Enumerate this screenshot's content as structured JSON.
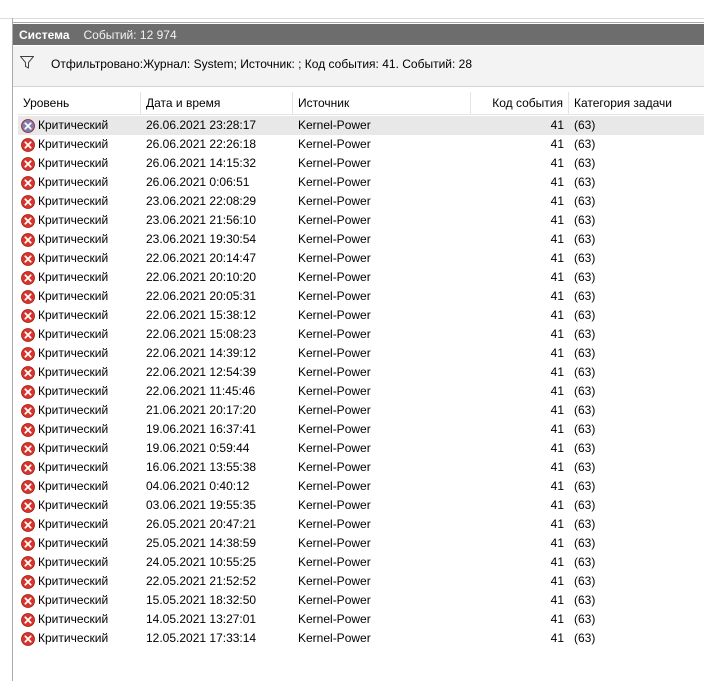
{
  "title_bar": {
    "name": "Система",
    "count": "Событий: 12 974"
  },
  "filter": {
    "text": "Отфильтровано:Журнал: System; Источник: ; Код события: 41. Событий: 28"
  },
  "columns": [
    "Уровень",
    "Дата и время",
    "Источник",
    "Код события",
    "Категория задачи"
  ],
  "colors": {
    "title_bar": "#6d6d6d",
    "filter_bar": "#f3f3f3",
    "error_red": "#d9342b",
    "selected_row": "#e8e8e8"
  },
  "rows": [
    {
      "level": "Критический",
      "datetime": "26.06.2021 23:28:17",
      "source": "Kernel-Power",
      "code": "41",
      "category": "(63)",
      "selected": true
    },
    {
      "level": "Критический",
      "datetime": "26.06.2021 22:26:18",
      "source": "Kernel-Power",
      "code": "41",
      "category": "(63)"
    },
    {
      "level": "Критический",
      "datetime": "26.06.2021 14:15:32",
      "source": "Kernel-Power",
      "code": "41",
      "category": "(63)"
    },
    {
      "level": "Критический",
      "datetime": "26.06.2021 0:06:51",
      "source": "Kernel-Power",
      "code": "41",
      "category": "(63)"
    },
    {
      "level": "Критический",
      "datetime": "23.06.2021 22:08:29",
      "source": "Kernel-Power",
      "code": "41",
      "category": "(63)"
    },
    {
      "level": "Критический",
      "datetime": "23.06.2021 21:56:10",
      "source": "Kernel-Power",
      "code": "41",
      "category": "(63)"
    },
    {
      "level": "Критический",
      "datetime": "23.06.2021 19:30:54",
      "source": "Kernel-Power",
      "code": "41",
      "category": "(63)"
    },
    {
      "level": "Критический",
      "datetime": "22.06.2021 20:14:47",
      "source": "Kernel-Power",
      "code": "41",
      "category": "(63)"
    },
    {
      "level": "Критический",
      "datetime": "22.06.2021 20:10:20",
      "source": "Kernel-Power",
      "code": "41",
      "category": "(63)"
    },
    {
      "level": "Критический",
      "datetime": "22.06.2021 20:05:31",
      "source": "Kernel-Power",
      "code": "41",
      "category": "(63)"
    },
    {
      "level": "Критический",
      "datetime": "22.06.2021 15:38:12",
      "source": "Kernel-Power",
      "code": "41",
      "category": "(63)"
    },
    {
      "level": "Критический",
      "datetime": "22.06.2021 15:08:23",
      "source": "Kernel-Power",
      "code": "41",
      "category": "(63)"
    },
    {
      "level": "Критический",
      "datetime": "22.06.2021 14:39:12",
      "source": "Kernel-Power",
      "code": "41",
      "category": "(63)"
    },
    {
      "level": "Критический",
      "datetime": "22.06.2021 12:54:39",
      "source": "Kernel-Power",
      "code": "41",
      "category": "(63)"
    },
    {
      "level": "Критический",
      "datetime": "22.06.2021 11:45:46",
      "source": "Kernel-Power",
      "code": "41",
      "category": "(63)"
    },
    {
      "level": "Критический",
      "datetime": "21.06.2021 20:17:20",
      "source": "Kernel-Power",
      "code": "41",
      "category": "(63)"
    },
    {
      "level": "Критический",
      "datetime": "19.06.2021 16:37:41",
      "source": "Kernel-Power",
      "code": "41",
      "category": "(63)"
    },
    {
      "level": "Критический",
      "datetime": "19.06.2021 0:59:44",
      "source": "Kernel-Power",
      "code": "41",
      "category": "(63)"
    },
    {
      "level": "Критический",
      "datetime": "16.06.2021 13:55:38",
      "source": "Kernel-Power",
      "code": "41",
      "category": "(63)"
    },
    {
      "level": "Критический",
      "datetime": "04.06.2021 0:40:12",
      "source": "Kernel-Power",
      "code": "41",
      "category": "(63)"
    },
    {
      "level": "Критический",
      "datetime": "03.06.2021 19:55:35",
      "source": "Kernel-Power",
      "code": "41",
      "category": "(63)"
    },
    {
      "level": "Критический",
      "datetime": "26.05.2021 20:47:21",
      "source": "Kernel-Power",
      "code": "41",
      "category": "(63)"
    },
    {
      "level": "Критический",
      "datetime": "25.05.2021 14:38:59",
      "source": "Kernel-Power",
      "code": "41",
      "category": "(63)"
    },
    {
      "level": "Критический",
      "datetime": "24.05.2021 10:55:25",
      "source": "Kernel-Power",
      "code": "41",
      "category": "(63)"
    },
    {
      "level": "Критический",
      "datetime": "22.05.2021 21:52:52",
      "source": "Kernel-Power",
      "code": "41",
      "category": "(63)"
    },
    {
      "level": "Критический",
      "datetime": "15.05.2021 18:32:50",
      "source": "Kernel-Power",
      "code": "41",
      "category": "(63)"
    },
    {
      "level": "Критический",
      "datetime": "14.05.2021 13:27:01",
      "source": "Kernel-Power",
      "code": "41",
      "category": "(63)"
    },
    {
      "level": "Критический",
      "datetime": "12.05.2021 17:33:14",
      "source": "Kernel-Power",
      "code": "41",
      "category": "(63)"
    }
  ]
}
